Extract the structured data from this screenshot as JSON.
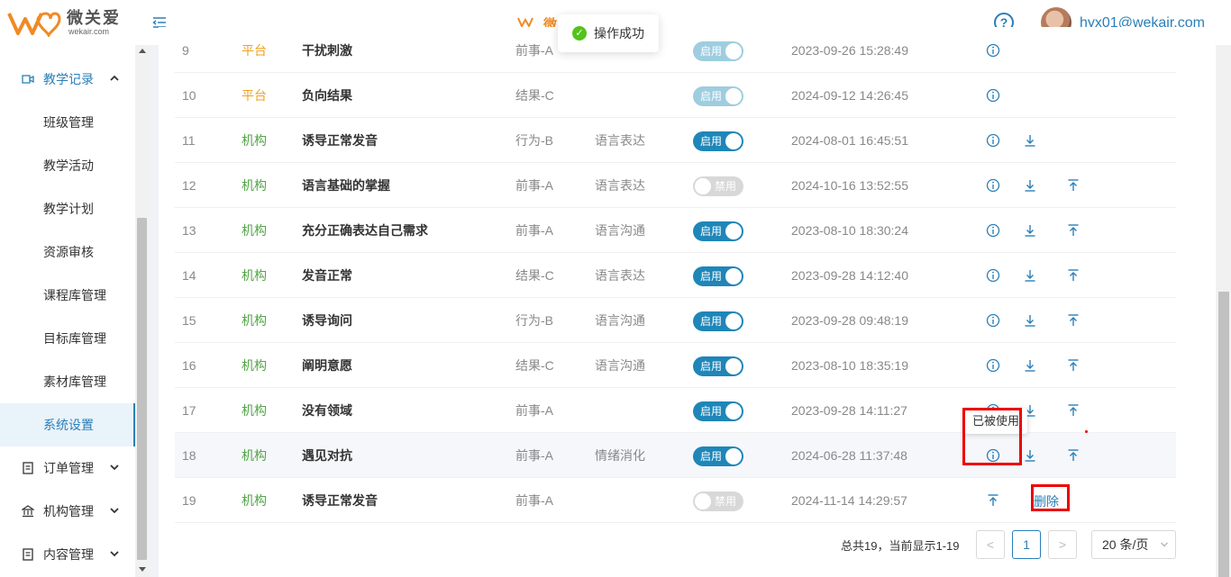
{
  "header": {
    "logo_cn": "微关爱",
    "logo_en": "wekair.com",
    "center_logo_cn": "微",
    "user_email": "hyx01@wekair.com",
    "help_label": "?"
  },
  "toast": {
    "message": "操作成功"
  },
  "sidebar": {
    "items": [
      {
        "label": "教学记录",
        "type": "group",
        "open": true
      },
      {
        "label": "班级管理",
        "type": "sub"
      },
      {
        "label": "教学活动",
        "type": "sub"
      },
      {
        "label": "教学计划",
        "type": "sub"
      },
      {
        "label": "资源审核",
        "type": "sub"
      },
      {
        "label": "课程库管理",
        "type": "sub"
      },
      {
        "label": "目标库管理",
        "type": "sub"
      },
      {
        "label": "素材库管理",
        "type": "sub"
      },
      {
        "label": "系统设置",
        "type": "sub",
        "active": true
      },
      {
        "label": "订单管理",
        "type": "group"
      },
      {
        "label": "机构管理",
        "type": "group"
      },
      {
        "label": "内容管理",
        "type": "group"
      }
    ]
  },
  "table": {
    "rows": [
      {
        "idx": "9",
        "source": "平台",
        "name": "干扰刺激",
        "category": "前事-A",
        "domain": "",
        "status": "启用",
        "faded": true,
        "time": "2023-09-26 15:28:49",
        "actions": [
          "info"
        ]
      },
      {
        "idx": "10",
        "source": "平台",
        "name": "负向结果",
        "category": "结果-C",
        "domain": "",
        "status": "启用",
        "faded": true,
        "time": "2024-09-12 14:26:45",
        "actions": [
          "info"
        ]
      },
      {
        "idx": "11",
        "source": "机构",
        "name": "诱导正常发音",
        "category": "行为-B",
        "domain": "语言表达",
        "status": "启用",
        "time": "2024-08-01 16:45:51",
        "actions": [
          "info",
          "down"
        ]
      },
      {
        "idx": "12",
        "source": "机构",
        "name": "语言基础的掌握",
        "category": "前事-A",
        "domain": "语言表达",
        "status": "禁用",
        "time": "2024-10-16 13:52:55",
        "actions": [
          "info",
          "down",
          "up"
        ]
      },
      {
        "idx": "13",
        "source": "机构",
        "name": "充分正确表达自己需求",
        "category": "前事-A",
        "domain": "语言沟通",
        "status": "启用",
        "time": "2023-08-10 18:30:24",
        "actions": [
          "info",
          "down",
          "up"
        ]
      },
      {
        "idx": "14",
        "source": "机构",
        "name": "发音正常",
        "category": "结果-C",
        "domain": "语言表达",
        "status": "启用",
        "time": "2023-09-28 14:12:40",
        "actions": [
          "info",
          "down",
          "up"
        ]
      },
      {
        "idx": "15",
        "source": "机构",
        "name": "诱导询问",
        "category": "行为-B",
        "domain": "语言沟通",
        "status": "启用",
        "time": "2023-09-28 09:48:19",
        "actions": [
          "info",
          "down",
          "up"
        ]
      },
      {
        "idx": "16",
        "source": "机构",
        "name": "阐明意愿",
        "category": "结果-C",
        "domain": "语言沟通",
        "status": "启用",
        "time": "2023-08-10 18:35:19",
        "actions": [
          "info",
          "down",
          "up"
        ]
      },
      {
        "idx": "17",
        "source": "机构",
        "name": "没有领域",
        "category": "前事-A",
        "domain": "",
        "status": "启用",
        "time": "2023-09-28 14:11:27",
        "actions": [
          "info",
          "down",
          "up"
        ]
      },
      {
        "idx": "18",
        "source": "机构",
        "name": "遇见对抗",
        "category": "前事-A",
        "domain": "情绪消化",
        "status": "启用",
        "time": "2024-06-28 11:37:48",
        "actions": [
          "info",
          "down",
          "up"
        ],
        "highlight": true
      },
      {
        "idx": "19",
        "source": "机构",
        "name": "诱导正常发音",
        "category": "前事-A",
        "domain": "",
        "status": "禁用",
        "time": "2024-11-14 14:29:57",
        "actions": [
          "up2"
        ]
      }
    ],
    "tooltip": "已被使用",
    "delete_label": "删除"
  },
  "pagination": {
    "total_text": "总共19，当前显示1-19",
    "current_page": "1",
    "prev": "<",
    "next": ">",
    "page_size": "20 条/页"
  },
  "colors": {
    "accent": "#2a7fb8",
    "switch_on": "#1f86b8",
    "platform": "#f0a020",
    "org": "#52a447",
    "annotation": "#ee0000"
  }
}
